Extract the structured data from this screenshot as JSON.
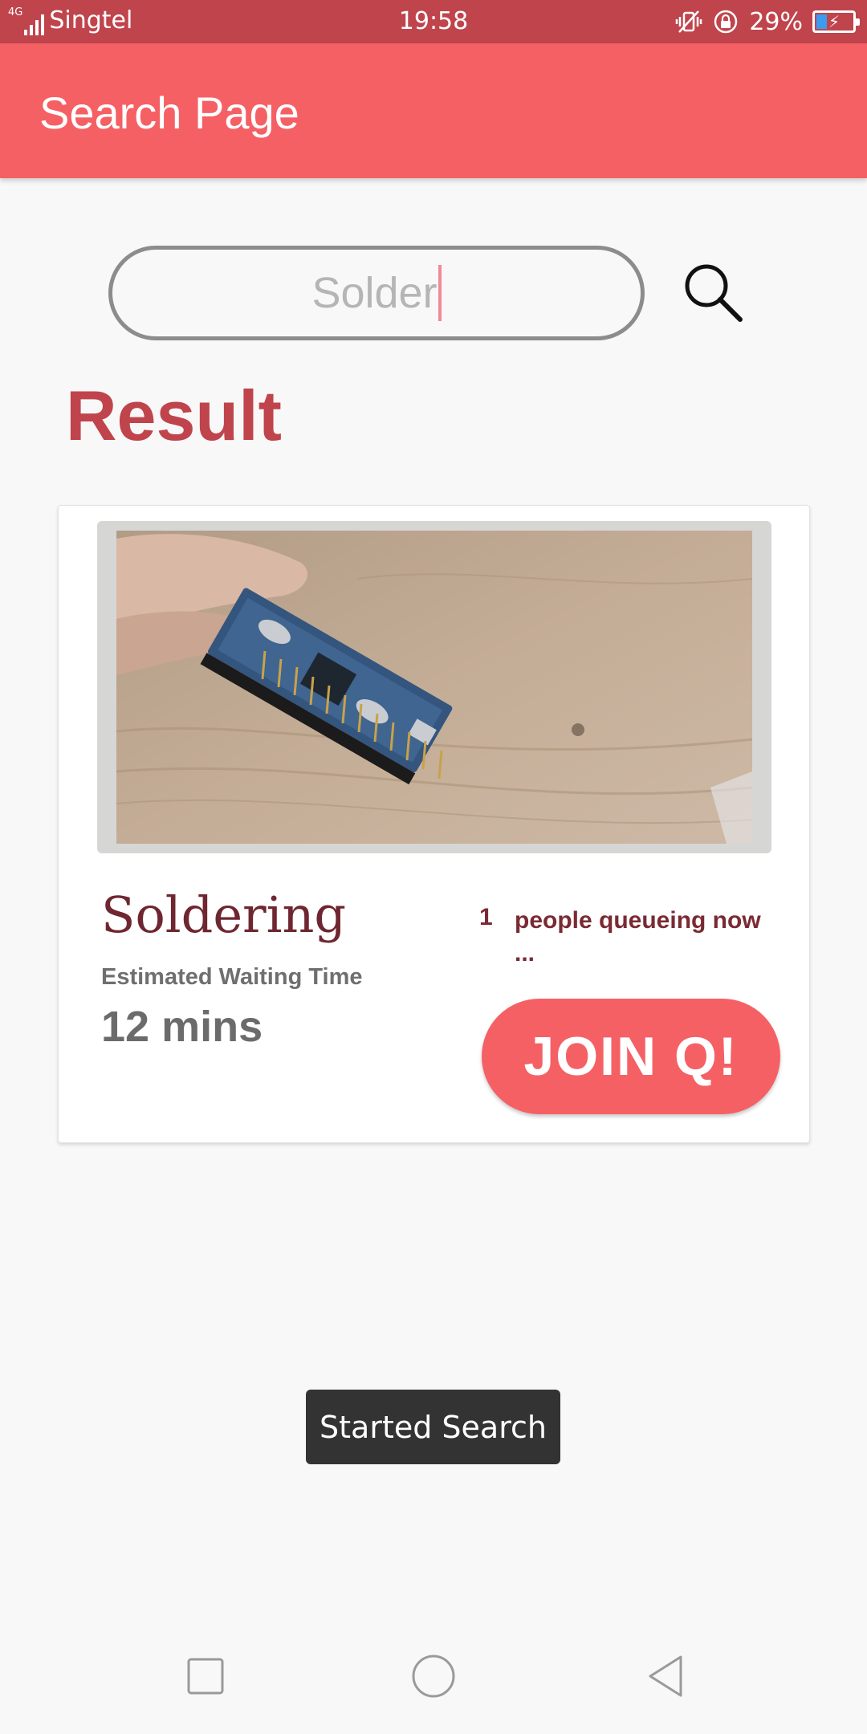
{
  "status_bar": {
    "network": "4G",
    "carrier": "Singtel",
    "time": "19:58",
    "battery_percent": "29%",
    "battery_level": 0.29,
    "icons": [
      "signal-icon",
      "vibrate-icon",
      "rotation-lock-icon",
      "battery-charging-icon"
    ]
  },
  "app_bar": {
    "title": "Search Page"
  },
  "search": {
    "value": "Solder",
    "button_icon": "search-icon"
  },
  "results": {
    "heading": "Result",
    "items": [
      {
        "name": "Soldering",
        "image_icon": "arduino-nano-board-photo",
        "wait_label": "Estimated Waiting Time",
        "wait_value": "12 mins",
        "queue_count": "1",
        "queue_text": "people queueing now ...",
        "join_label": "JOIN Q!"
      }
    ]
  },
  "toast": {
    "message": "Started Search"
  },
  "nav_bar": {
    "icons": [
      "recent-apps-icon",
      "home-icon",
      "back-icon"
    ]
  },
  "colors": {
    "status_bar": "#c0444c",
    "accent": "#f56065",
    "result_heading": "#c0444c",
    "service_name": "#6e2630",
    "queue_text": "#7a2a33",
    "toast_bg": "#333333",
    "background": "#f8f8f8"
  }
}
